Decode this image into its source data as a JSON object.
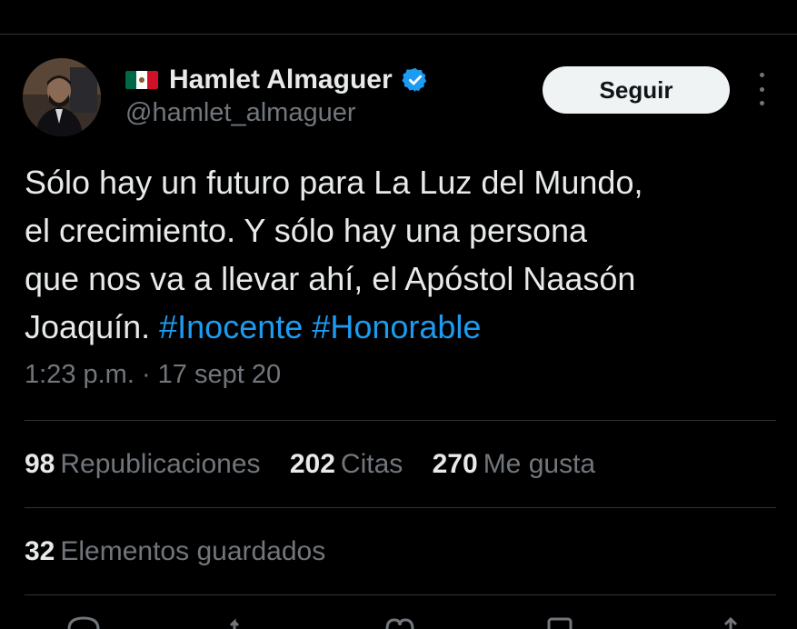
{
  "author": {
    "name": "Hamlet Almaguer",
    "handle": "@hamlet_almaguer",
    "flag_icon": "mexico-flag-icon",
    "verified_icon": "verified-badge-icon"
  },
  "follow_button": {
    "label": "Seguir"
  },
  "tweet": {
    "lines": [
      "Sólo hay un futuro para La Luz del Mundo,",
      "el crecimiento. Y sólo hay una persona",
      "que nos va a llevar ahí, el Apóstol Naasón"
    ],
    "last_line_text": "Joaquín.",
    "hashtags": [
      "#Inocente",
      "#Honorable"
    ],
    "timestamp": "1:23 p.m. · 17 sept 20"
  },
  "stats": {
    "reposts": {
      "count": "98",
      "label": "Republicaciones"
    },
    "quotes": {
      "count": "202",
      "label": "Citas"
    },
    "likes": {
      "count": "270",
      "label": "Me gusta"
    },
    "bookmarks": {
      "count": "32",
      "label": "Elementos guardados"
    }
  },
  "colors": {
    "background": "#000000",
    "text": "#e7e9ea",
    "secondary": "#71767b",
    "hashtag": "#1d9bf0",
    "verified": "#1d9bf0"
  }
}
